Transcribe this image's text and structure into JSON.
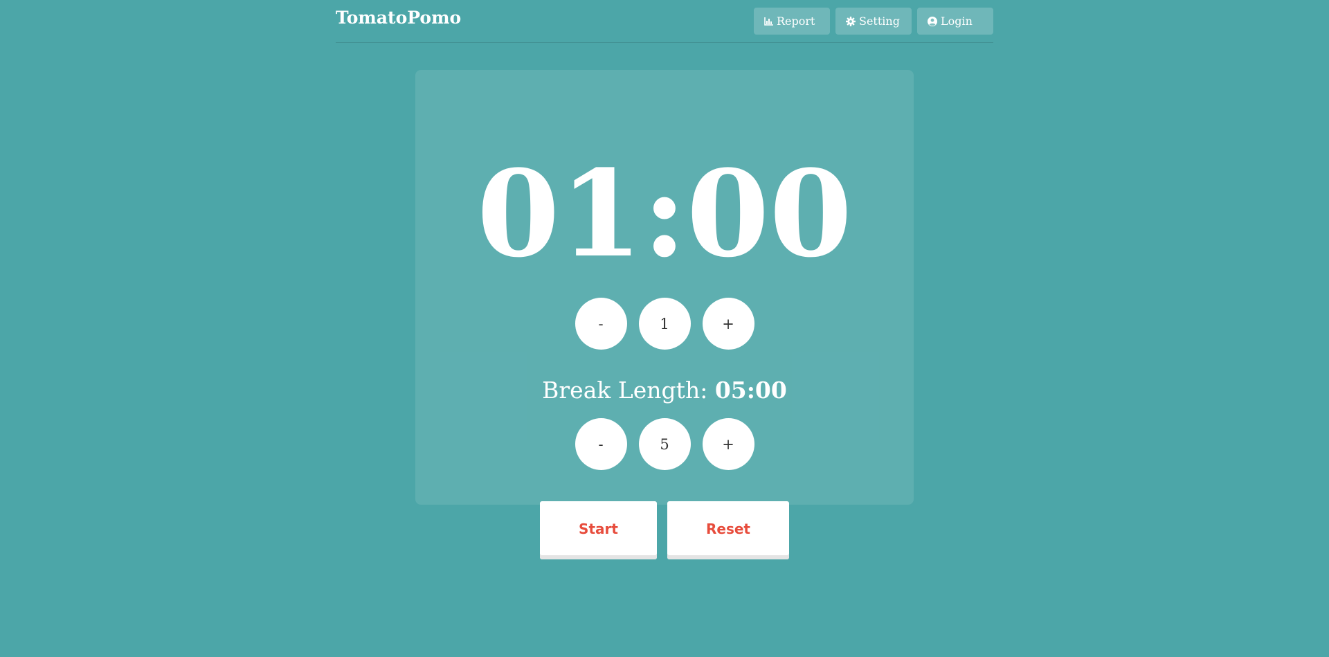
{
  "header": {
    "brand": "TomatoPomo",
    "nav": [
      {
        "label": "Report",
        "icon": "bar-chart-icon"
      },
      {
        "label": "Setting",
        "icon": "gear-icon"
      },
      {
        "label": "Login",
        "icon": "user-circle-icon"
      }
    ]
  },
  "timer": {
    "display": "01:00",
    "session": {
      "decrement_label": "-",
      "value": "1",
      "increment_label": "+"
    }
  },
  "break": {
    "label": "Break Length: ",
    "display": "05:00",
    "decrement_label": "-",
    "value": "5",
    "increment_label": "+"
  },
  "actions": {
    "start_label": "Start",
    "reset_label": "Reset"
  },
  "colors": {
    "background": "#4ca6a8",
    "accent": "#e74c3c",
    "text": "#ffffff"
  }
}
